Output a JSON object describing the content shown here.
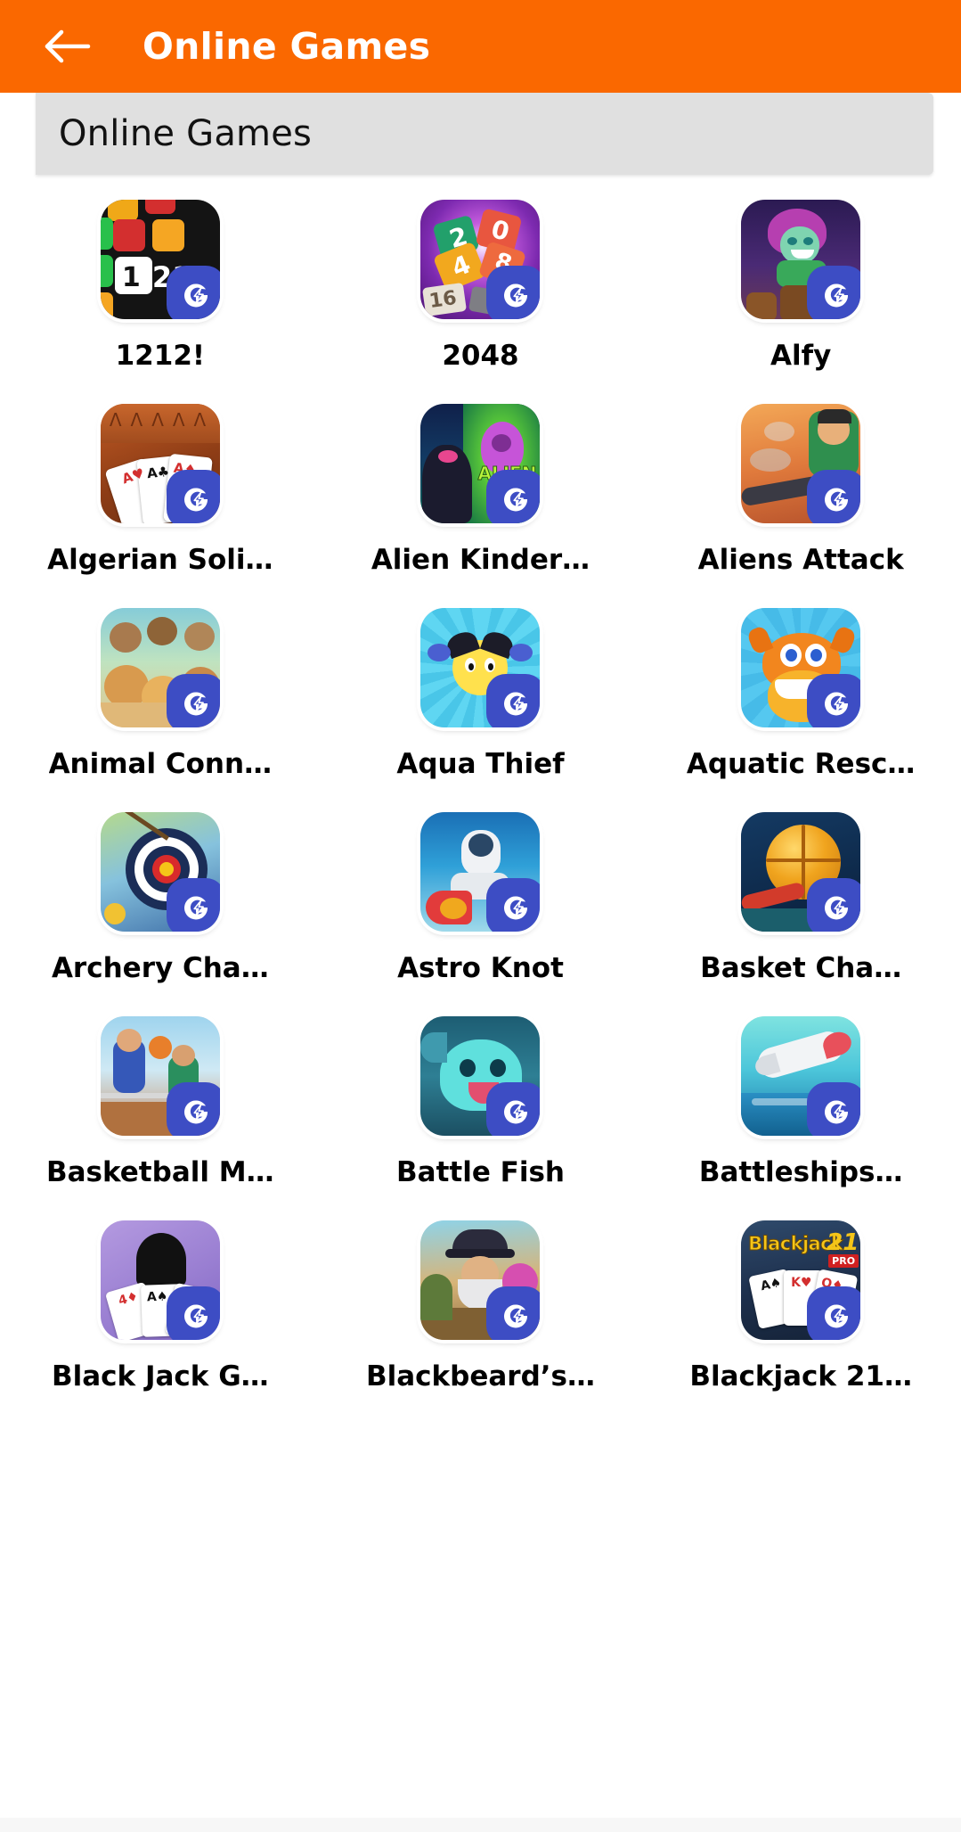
{
  "appbar": {
    "back_icon": "arrow-left-icon",
    "title": "Online Games",
    "background": "#FA6800",
    "text_color": "#FFFFFF"
  },
  "section": {
    "title": "Online Games",
    "background": "#E0E0E0"
  },
  "badge": {
    "icon": "gamezop-g-icon",
    "color": "#3D4DC4"
  },
  "grid": {
    "columns": 3,
    "tiles": [
      {
        "label": "1212!",
        "art": "a-blocks",
        "icon_name": "game-icon-1212"
      },
      {
        "label": "2048",
        "art": "a-2048",
        "icon_name": "game-icon-2048"
      },
      {
        "label": "Alfy",
        "art": "a-alfy",
        "icon_name": "game-icon-alfy"
      },
      {
        "label": "Algerian Soli…",
        "art": "a-algerian",
        "icon_name": "game-icon-algerian-solitaire"
      },
      {
        "label": "Alien Kinder…",
        "art": "a-alienk",
        "icon_name": "game-icon-alien-kindergarten"
      },
      {
        "label": "Aliens Attack",
        "art": "a-aliensatk",
        "icon_name": "game-icon-aliens-attack"
      },
      {
        "label": "Animal Conn…",
        "art": "a-animal",
        "icon_name": "game-icon-animal-connection"
      },
      {
        "label": "Aqua Thief",
        "art": "a-aqua",
        "icon_name": "game-icon-aqua-thief"
      },
      {
        "label": "Aquatic Resc…",
        "art": "a-aquatic",
        "icon_name": "game-icon-aquatic-rescue"
      },
      {
        "label": "Archery Cha…",
        "art": "a-archery",
        "icon_name": "game-icon-archery-challenge"
      },
      {
        "label": "Astro Knot",
        "art": "a-astro",
        "icon_name": "game-icon-astro-knot"
      },
      {
        "label": "Basket Cha…",
        "art": "a-basket",
        "icon_name": "game-icon-basket-challenge"
      },
      {
        "label": "Basketball M…",
        "art": "a-basketball",
        "icon_name": "game-icon-basketball-master"
      },
      {
        "label": "Battle Fish",
        "art": "a-battlefish",
        "icon_name": "game-icon-battle-fish"
      },
      {
        "label": "Battleships…",
        "art": "a-battleship",
        "icon_name": "game-icon-battleships"
      },
      {
        "label": "Black Jack G…",
        "art": "a-blackjackg",
        "icon_name": "game-icon-black-jack-gold"
      },
      {
        "label": "Blackbeard’s…",
        "art": "a-blackbeard",
        "icon_name": "game-icon-blackbeards-island"
      },
      {
        "label": "Blackjack 21…",
        "art": "a-blackjack21",
        "icon_name": "game-icon-blackjack-21-pro"
      }
    ]
  }
}
